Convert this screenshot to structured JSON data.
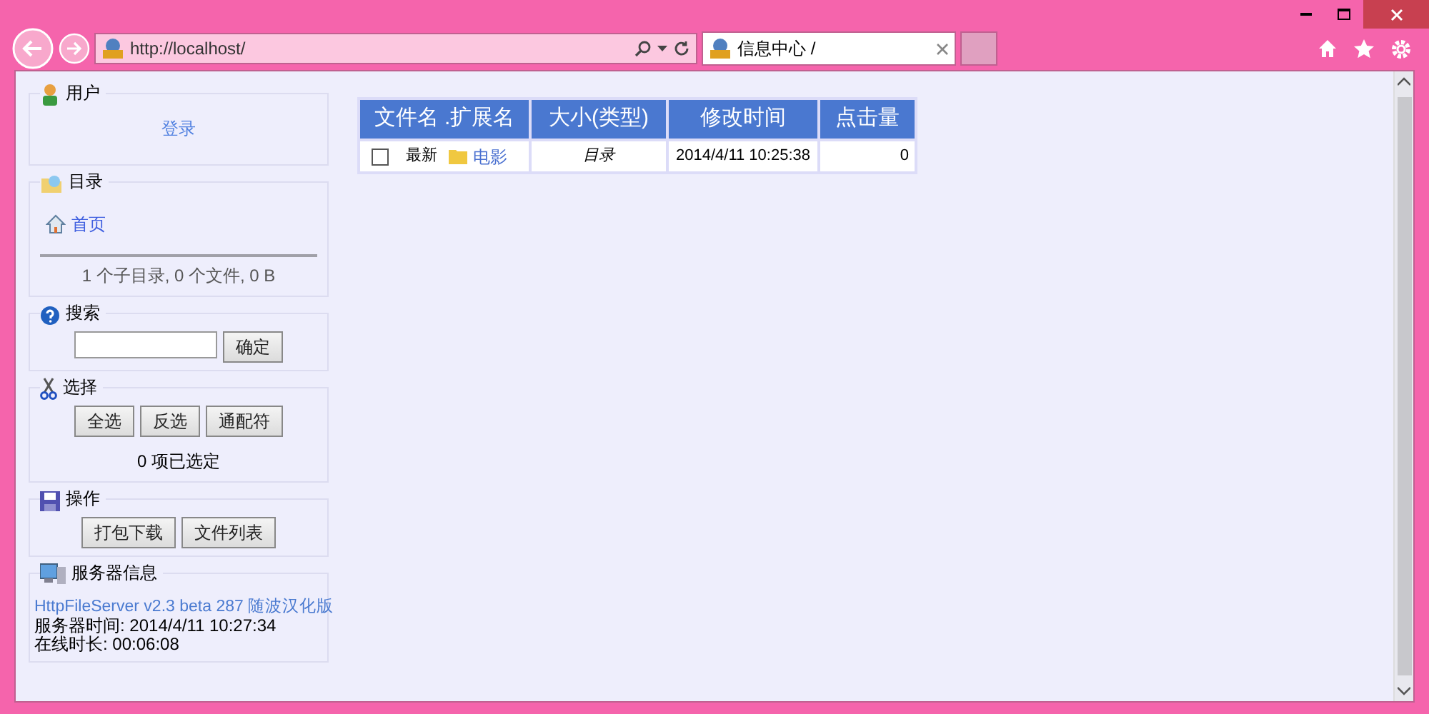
{
  "browser": {
    "address": "http://localhost/",
    "tab": {
      "title": "信息中心 /",
      "selected": true
    }
  },
  "sidebar": [
    {
      "kind": "user",
      "title": "用户",
      "link": "登录"
    },
    {
      "kind": "folder",
      "title": "目录",
      "home_link": "首页",
      "summary": "1 个子目录, 0 个文件, 0 B"
    },
    {
      "kind": "search",
      "title": "搜索",
      "button": "确定"
    },
    {
      "kind": "select",
      "title": "选择",
      "buttons": [
        "全选",
        "反选",
        "通配符"
      ],
      "status": "0 项已选定"
    },
    {
      "kind": "actions",
      "title": "操作",
      "buttons": [
        "打包下载",
        "文件列表"
      ]
    },
    {
      "kind": "server",
      "title": "服务器信息",
      "link": "HttpFileServer v2.3 beta 287 随波汉化版",
      "lines": [
        "服务器时间: 2014/4/11 10:27:34",
        "在线时长: 00:06:08"
      ]
    }
  ],
  "table": {
    "columns": [
      "文件名 .扩展名",
      "大小(类型)",
      "修改时间",
      "点击量"
    ],
    "rows": [
      {
        "checked": false,
        "badge": "最新",
        "name": "电影",
        "type": "目录",
        "modified": "2014/4/11 10:25:38",
        "hits": "0"
      }
    ]
  }
}
